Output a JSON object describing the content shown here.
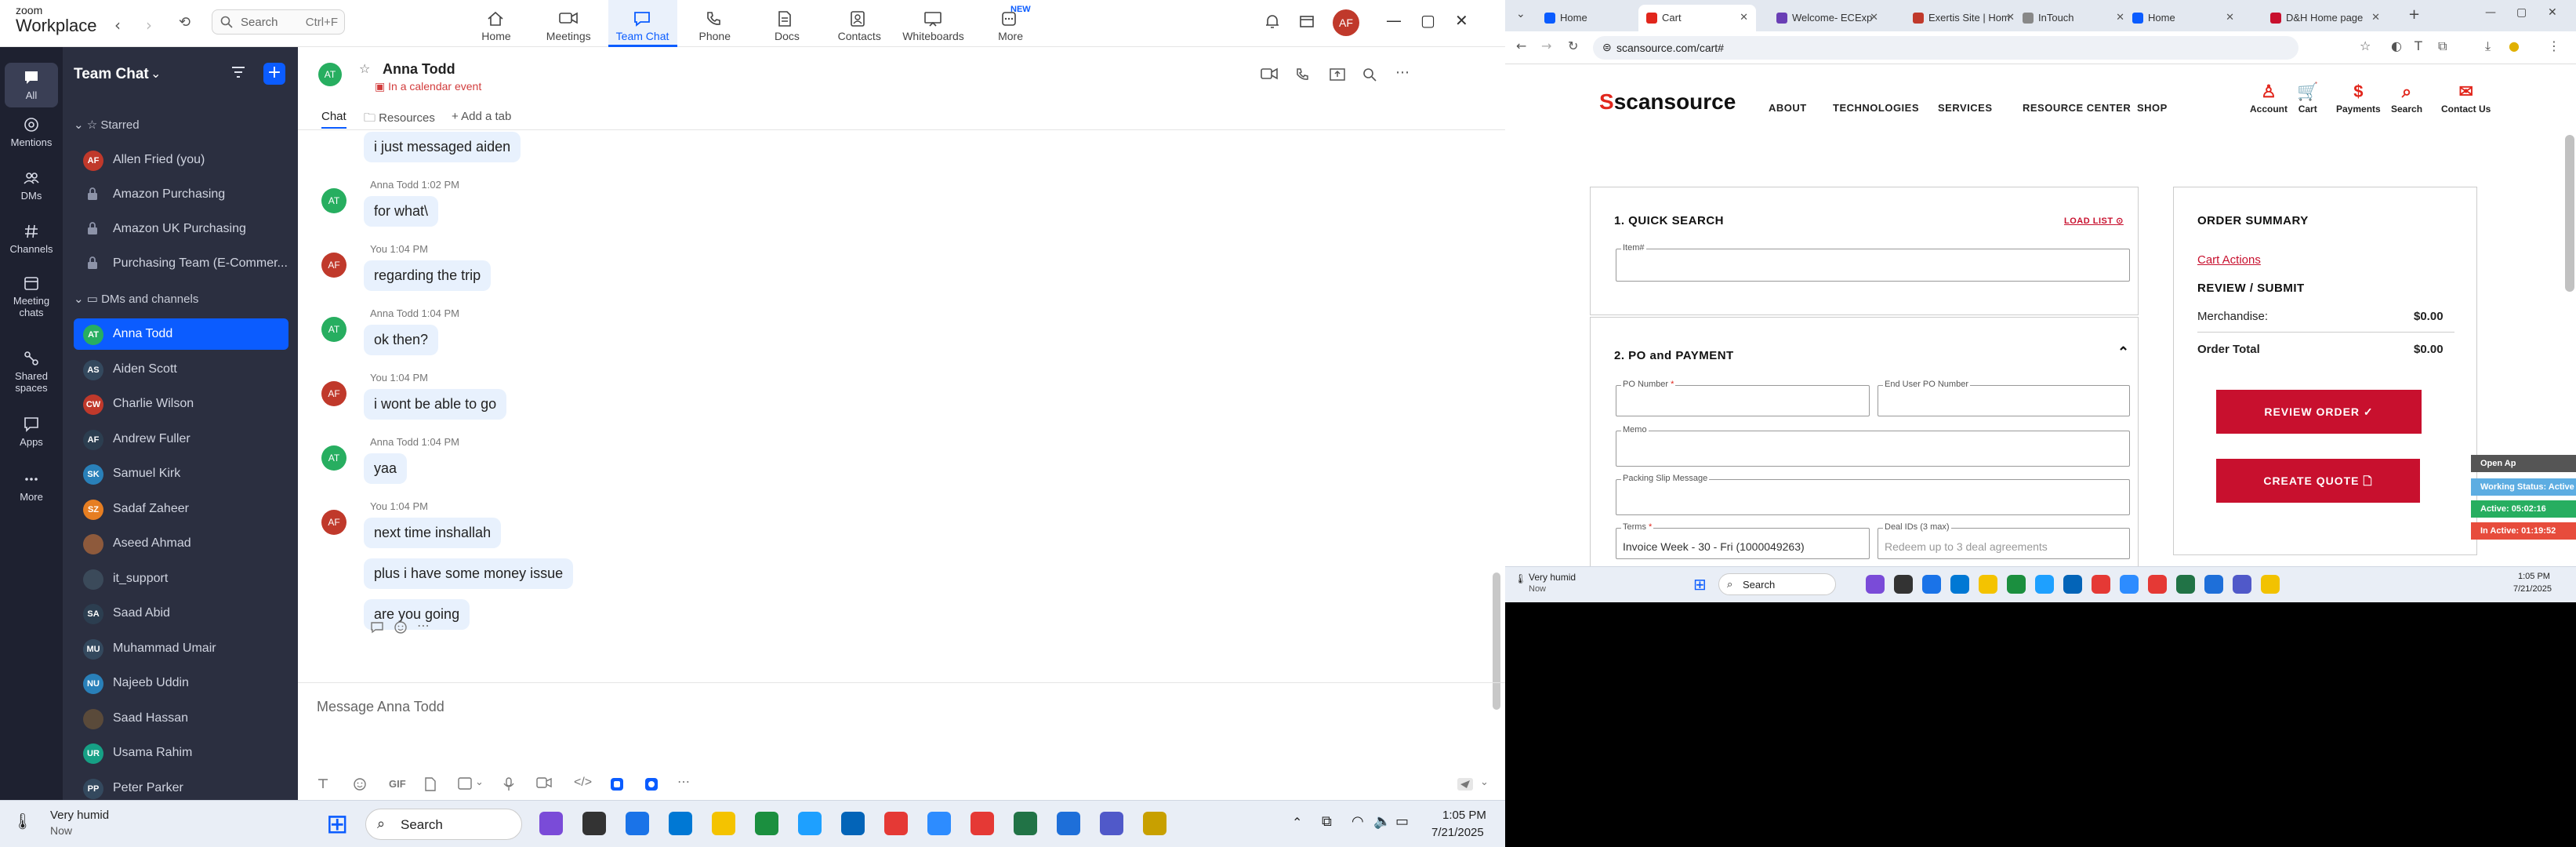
{
  "zoom": {
    "logo_line1": "zoom",
    "logo_line2": "Workplace",
    "search_placeholder": "Search",
    "search_shortcut": "Ctrl+F",
    "tabs": [
      {
        "label": "Home",
        "icon": "home-icon"
      },
      {
        "label": "Meetings",
        "icon": "video-icon"
      },
      {
        "label": "Team Chat",
        "icon": "chat-icon"
      },
      {
        "label": "Phone",
        "icon": "phone-icon"
      },
      {
        "label": "Docs",
        "icon": "docs-icon"
      },
      {
        "label": "Contacts",
        "icon": "contacts-icon"
      },
      {
        "label": "Whiteboards",
        "icon": "whiteboard-icon"
      },
      {
        "label": "More",
        "icon": "more-icon"
      }
    ],
    "more_badge": "NEW",
    "user_initials": "AF",
    "rail": [
      {
        "label": "All",
        "icon": "chat-bubble-icon"
      },
      {
        "label": "Mentions",
        "icon": "at-icon"
      },
      {
        "label": "DMs",
        "icon": "people-icon"
      },
      {
        "label": "Channels",
        "icon": "hash-icon"
      },
      {
        "label": "Meeting chats",
        "label2": "chats",
        "icon": "calendar-icon"
      },
      {
        "label": "Shared spaces",
        "label2": "spaces",
        "icon": "shared-icon"
      },
      {
        "label": "Apps",
        "icon": "apps-icon"
      },
      {
        "label": "More",
        "icon": "ellipsis-icon"
      }
    ],
    "sidebar": {
      "title": "Team Chat",
      "starred_label": "Starred",
      "starred": [
        {
          "name": "Allen Fried (you)",
          "initials": "AF",
          "color": "#c0392b",
          "locked": false
        },
        {
          "name": "Amazon Purchasing",
          "locked": true
        },
        {
          "name": "Amazon UK Purchasing",
          "locked": true
        },
        {
          "name": "Purchasing Team (E-Commer...",
          "locked": true
        }
      ],
      "dms_label": "DMs and channels",
      "dms": [
        {
          "name": "Anna Todd",
          "initials": "AT",
          "color": "#27ae60"
        },
        {
          "name": "Aiden Scott",
          "initials": "AS",
          "color": "#34495e"
        },
        {
          "name": "Charlie Wilson",
          "initials": "CW",
          "color": "#c0392b"
        },
        {
          "name": "Andrew Fuller",
          "initials": "AF",
          "color": "#2c3e50"
        },
        {
          "name": "Samuel Kirk",
          "initials": "SK",
          "color": "#2980b9"
        },
        {
          "name": "Sadaf Zaheer",
          "initials": "SZ",
          "color": "#e67e22"
        },
        {
          "name": "Aseed Ahmad",
          "initials": "",
          "color": "#8e5a3c"
        },
        {
          "name": "it_support",
          "initials": "",
          "color": "#3b4a5a"
        },
        {
          "name": "Saad Abid",
          "initials": "SA",
          "color": "#2c3e50"
        },
        {
          "name": "Muhammad Umair",
          "initials": "MU",
          "color": "#34495e"
        },
        {
          "name": "Najeeb Uddin",
          "initials": "NU",
          "color": "#2980b9"
        },
        {
          "name": "Saad Hassan",
          "initials": "",
          "color": "#5a4a3a"
        },
        {
          "name": "Usama Rahim",
          "initials": "UR",
          "color": "#16a085"
        },
        {
          "name": "Peter Parker",
          "initials": "PP",
          "color": "#34495e"
        }
      ]
    },
    "chat": {
      "contact_name": "Anna Todd",
      "contact_initials": "AT",
      "status": "In a calendar event",
      "tabs": [
        "Chat",
        "Resources",
        "Add a tab"
      ],
      "messages": [
        {
          "sender": "",
          "time": "",
          "text": "i just messaged aiden",
          "av": "",
          "color": ""
        },
        {
          "sender": "Anna Todd",
          "time": "1:02 PM",
          "text": "for what\\",
          "av": "AT",
          "color": "#27ae60"
        },
        {
          "sender": "You",
          "time": "1:04 PM",
          "text": "regarding the trip",
          "av": "AF",
          "color": "#c0392b"
        },
        {
          "sender": "Anna Todd",
          "time": "1:04 PM",
          "text": "ok then?",
          "av": "AT",
          "color": "#27ae60"
        },
        {
          "sender": "You",
          "time": "1:04 PM",
          "text": "i wont be able to go",
          "av": "AF",
          "color": "#c0392b"
        },
        {
          "sender": "Anna Todd",
          "time": "1:04 PM",
          "text": "yaa",
          "av": "AT",
          "color": "#27ae60"
        },
        {
          "sender": "You",
          "time": "1:04 PM",
          "text": "next time inshallah",
          "av": "AF",
          "color": "#c0392b"
        },
        {
          "sender": "",
          "time": "",
          "text": "plus i have some money issue",
          "av": "",
          "color": ""
        },
        {
          "sender": "",
          "time": "",
          "text": "are you going",
          "av": "",
          "color": ""
        }
      ],
      "compose_placeholder": "Message Anna Todd",
      "gif_label": "GIF"
    }
  },
  "browser": {
    "tabs": [
      {
        "title": "Home",
        "color": "#0b5cff"
      },
      {
        "title": "Cart",
        "color": "#e1261c"
      },
      {
        "title": "Welcome- ECExp",
        "color": "#6a3fb5"
      },
      {
        "title": "Exertis Site | Hom",
        "color": "#c0392b"
      },
      {
        "title": "InTouch",
        "color": "#888"
      },
      {
        "title": "Home",
        "color": "#0b5cff"
      },
      {
        "title": "D&H Home page",
        "color": "#c8102e"
      }
    ],
    "url": "scansource.com/cart#",
    "site": {
      "logo": "scansource",
      "nav": [
        "ABOUT",
        "TECHNOLOGIES",
        "SERVICES",
        "RESOURCE CENTER",
        "SHOP"
      ],
      "icons": [
        "Account",
        "Cart",
        "Payments",
        "Search",
        "Contact Us"
      ],
      "quick_search_title": "1. QUICK SEARCH",
      "load_list": "LOAD LIST",
      "item_label": "Item#",
      "po_title": "2. PO and PAYMENT",
      "po_number_label": "PO Number",
      "end_user_po_label": "End User PO Number",
      "memo_label": "Memo",
      "packing_slip_label": "Packing Slip Message",
      "terms_label": "Terms",
      "terms_value": "Invoice Week - 30 - Fri (1000049263)",
      "deal_ids_label": "Deal IDs (3 max)",
      "deal_ids_placeholder": "Redeem up to 3 deal agreements",
      "order_summary_title": "ORDER SUMMARY",
      "cart_actions": "Cart Actions",
      "review_submit": "REVIEW / SUBMIT",
      "merchandise_label": "Merchandise:",
      "merchandise_value": "$0.00",
      "order_total_label": "Order Total",
      "order_total_value": "$0.00",
      "review_order_btn": "REVIEW ORDER ✓",
      "create_quote_btn": "CREATE QUOTE 🗋"
    },
    "widget": {
      "open": "Open Ap",
      "working": "Working Status: Active",
      "active": "Active: 05:02:16",
      "inactive": "In Active: 01:19:52"
    },
    "taskbar": {
      "weather": "Very humid",
      "weather_sub": "Now",
      "search": "Search",
      "time": "1:05 PM",
      "date": "7/21/2025"
    }
  },
  "taskbar": {
    "weather": "Very humid",
    "weather_sub": "Now",
    "search": "Search",
    "time": "1:05 PM",
    "date": "7/21/2025"
  }
}
